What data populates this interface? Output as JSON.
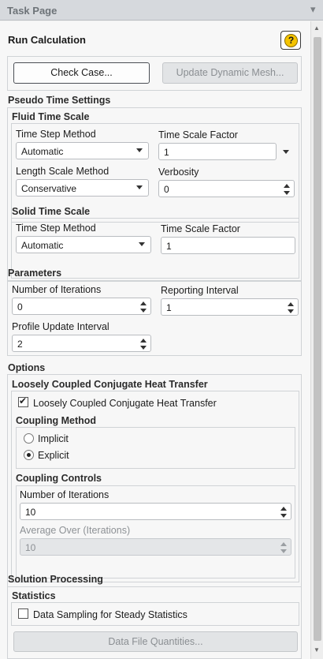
{
  "panel": {
    "title": "Task Page",
    "more_icon": "chevron-down-icon"
  },
  "header": {
    "title": "Run Calculation",
    "help_icon": "help-icon",
    "help_glyph": "?"
  },
  "actions": {
    "check_case": "Check Case...",
    "update_mesh": "Update Dynamic Mesh..."
  },
  "pseudo_time": {
    "title": "Pseudo Time Settings",
    "fluid": {
      "title": "Fluid Time Scale",
      "time_step_method_label": "Time Step Method",
      "time_step_method_value": "Automatic",
      "time_scale_factor_label": "Time Scale Factor",
      "time_scale_factor_value": "1",
      "length_scale_method_label": "Length Scale Method",
      "length_scale_method_value": "Conservative",
      "verbosity_label": "Verbosity",
      "verbosity_value": "0"
    },
    "solid": {
      "title": "Solid Time Scale",
      "time_step_method_label": "Time Step Method",
      "time_step_method_value": "Automatic",
      "time_scale_factor_label": "Time Scale Factor",
      "time_scale_factor_value": "1"
    }
  },
  "parameters": {
    "title": "Parameters",
    "iterations_label": "Number of Iterations",
    "iterations_value": "0",
    "reporting_label": "Reporting Interval",
    "reporting_value": "1",
    "profile_label": "Profile Update Interval",
    "profile_value": "2"
  },
  "options": {
    "title": "Options",
    "lcht": {
      "title": "Loosely Coupled Conjugate Heat Transfer",
      "checkbox_label": "Loosely Coupled Conjugate Heat Transfer",
      "checked": true,
      "check_glyph": "✔",
      "coupling_method_title": "Coupling Method",
      "implicit_label": "Implicit",
      "explicit_label": "Explicit",
      "selected": "Explicit",
      "coupling_controls_title": "Coupling Controls",
      "iterations_label": "Number of Iterations",
      "iterations_value": "10",
      "average_label": "Average Over (Iterations)",
      "average_value": "10"
    }
  },
  "solution_processing": {
    "title": "Solution Processing",
    "statistics_title": "Statistics",
    "sampling_label": "Data Sampling for Steady Statistics",
    "sampling_checked": false,
    "data_file_button": "Data File Quantities..."
  },
  "colors": {
    "title_bar": "#d6d9dd",
    "panel_bg": "#f7f7f7",
    "help_border": "#3a3a3a",
    "help_fill": "#f5c400"
  }
}
